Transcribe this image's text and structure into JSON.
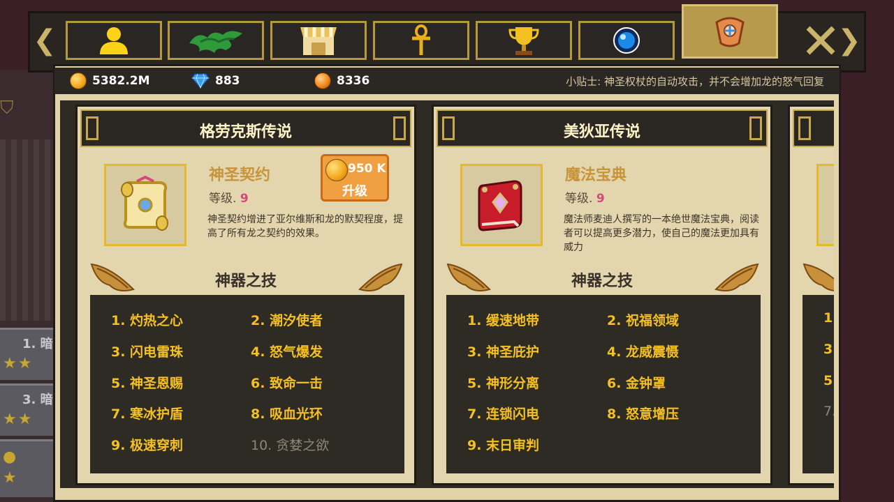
{
  "tabs": [
    {
      "icon": "profile-icon",
      "active": false
    },
    {
      "icon": "dragon-icon",
      "active": false
    },
    {
      "icon": "shop-icon",
      "active": false
    },
    {
      "icon": "ankh-icon",
      "active": false
    },
    {
      "icon": "trophy-icon",
      "active": false
    },
    {
      "icon": "orb-icon",
      "active": false
    },
    {
      "icon": "artifact-icon",
      "active": true
    }
  ],
  "currency": {
    "gold": "5382.2M",
    "gems": "883",
    "orbs": "8336"
  },
  "tip": "小贴士: 神圣权杖的自动攻击，并不会增加龙的怒气回复",
  "left_panel": {
    "row1_label": "1. 暗",
    "row2_label": "3. 暗"
  },
  "cards": [
    {
      "title": "格劳克斯传说",
      "item_name": "神圣契约",
      "level_label": "等级.",
      "level_value": "9",
      "description": "神圣契约增进了亚尔维斯和龙的默契程度，提高了所有龙之契约的效果。",
      "upgrade_cost": "950 K",
      "upgrade_label": "升级",
      "skills_title": "神器之技",
      "skills": [
        "1. 灼热之心",
        "2. 潮汐使者",
        "3. 闪电雷珠",
        "4. 怒气爆发",
        "5. 神圣恩赐",
        "6. 致命一击",
        "7. 寒冰护盾",
        "8. 吸血光环",
        "9. 极速穿刺",
        "10. 贪婪之欲"
      ]
    },
    {
      "title": "美狄亚传说",
      "item_name": "魔法宝典",
      "level_label": "等级.",
      "level_value": "9",
      "description": "魔法师麦迪人撰写的一本绝世魔法宝典，阅读者可以提高更多潜力，使自己的魔法更加具有威力",
      "skills_title": "神器之技",
      "skills": [
        "1. 缓速地带",
        "2. 祝福领域",
        "3. 神圣庇护",
        "4. 龙威震慑",
        "5. 神形分离",
        "6. 金钟罩",
        "7. 连锁闪电",
        "8. 怒意增压",
        "9. 末日审判"
      ]
    },
    {
      "skills": [
        "1.",
        "3.",
        "5.",
        "7."
      ]
    }
  ],
  "colors": {
    "skill_active": "#f4c024",
    "skill_locked": "#8e8878",
    "level_value": "#d24a7a",
    "item_name": "#c8943a"
  }
}
